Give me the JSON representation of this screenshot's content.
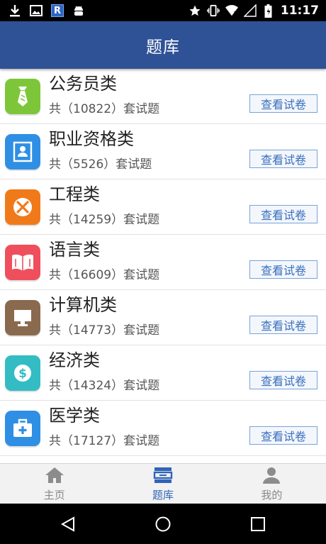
{
  "status_bar": {
    "time": "11:17",
    "left_icons": [
      "download-icon",
      "image-icon",
      "r-app-icon",
      "android-icon"
    ],
    "right_icons": [
      "star-icon",
      "vibrate-icon",
      "wifi-icon",
      "signal-icon",
      "battery-icon"
    ],
    "r_label": "R"
  },
  "header": {
    "title": "题库"
  },
  "categories": [
    {
      "name": "公务员类",
      "count": "共（10822）套试题",
      "button": "查看试卷",
      "icon": "tie-icon",
      "color": "#7dc63a"
    },
    {
      "name": "职业资格类",
      "count": "共（5526）套试题",
      "button": "查看试卷",
      "icon": "id-card-icon",
      "color": "#2f8fe4"
    },
    {
      "name": "工程类",
      "count": "共（14259）套试题",
      "button": "查看试卷",
      "icon": "tools-icon",
      "color": "#f07a1a"
    },
    {
      "name": "语言类",
      "count": "共（16609）套试题",
      "button": "查看试卷",
      "icon": "book-icon",
      "color": "#ef4f5c"
    },
    {
      "name": "计算机类",
      "count": "共（14773）套试题",
      "button": "查看试卷",
      "icon": "monitor-icon",
      "color": "#8a6a4f"
    },
    {
      "name": "经济类",
      "count": "共（14324）套试题",
      "button": "查看试卷",
      "icon": "dollar-icon",
      "color": "#33bcc4"
    },
    {
      "name": "医学类",
      "count": "共（17127）套试题",
      "button": "查看试卷",
      "icon": "medical-kit-icon",
      "color": "#2f8fe4"
    }
  ],
  "tabs": [
    {
      "label": "主页",
      "icon": "home-icon",
      "active": false
    },
    {
      "label": "题库",
      "icon": "question-bank-icon",
      "active": true
    },
    {
      "label": "我的",
      "icon": "user-icon",
      "active": false
    }
  ],
  "nav_bar": {
    "icons": [
      "back-icon",
      "home-circle-icon",
      "recents-icon"
    ]
  },
  "colors": {
    "header": "#2f5296",
    "accent": "#2f64b8",
    "button_border": "#7aa3d6"
  }
}
